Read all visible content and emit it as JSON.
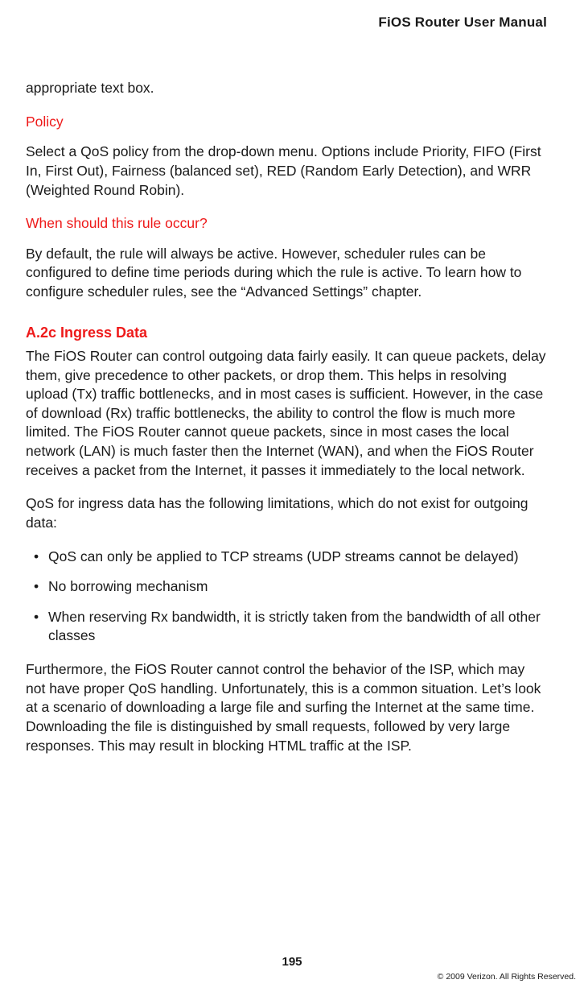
{
  "header": {
    "title": "FiOS Router User Manual"
  },
  "body": {
    "lead_fragment": "appropriate text box.",
    "policy": {
      "heading": "Policy",
      "text": "Select a QoS policy from the drop-down menu. Options include Priority, FIFO (First In, First Out), Fairness (balanced set), RED (Random Early Detection), and WRR (Weighted Round Robin)."
    },
    "when": {
      "heading": "When should this rule occur?",
      "text": "By default, the rule will always be active. However, scheduler rules can be configured to define time periods during which the rule is active. To learn how to configure scheduler rules, see the “Advanced Settings” chapter."
    },
    "ingress": {
      "heading": "A.2c  Ingress Data",
      "p1": "The FiOS Router can control outgoing data fairly easily. It can queue packets, delay them, give precedence to other packets, or drop them. This helps in resolving upload (Tx) traffic bottlenecks, and in most cases is sufficient. However, in the case of download (Rx) traffic bottlenecks, the ability to control the flow is much more limited. The FiOS Router cannot queue packets, since in most cases the local network (LAN) is much faster then the Internet (WAN), and when the FiOS Router receives a packet from the Internet, it passes it immediately to the local network.",
      "p2": "QoS for ingress data has the following limitations, which do not exist for outgoing data:",
      "bullets": [
        "QoS can only be applied to TCP streams (UDP streams cannot be delayed)",
        "No borrowing mechanism",
        "When reserving Rx bandwidth, it is strictly taken from the bandwidth of all other classes"
      ],
      "p3": "Furthermore, the FiOS Router cannot control the behavior of the ISP, which may not have proper QoS handling. Unfortunately, this is a common situation. Let’s look at a scenario of downloading a large file and surfing the Internet at the same time. Downloading the file is distinguished by small requests, followed by very large responses. This may result in blocking HTML traffic at the ISP."
    }
  },
  "footer": {
    "page_number": "195",
    "copyright": "© 2009 Verizon. All Rights Reserved."
  }
}
